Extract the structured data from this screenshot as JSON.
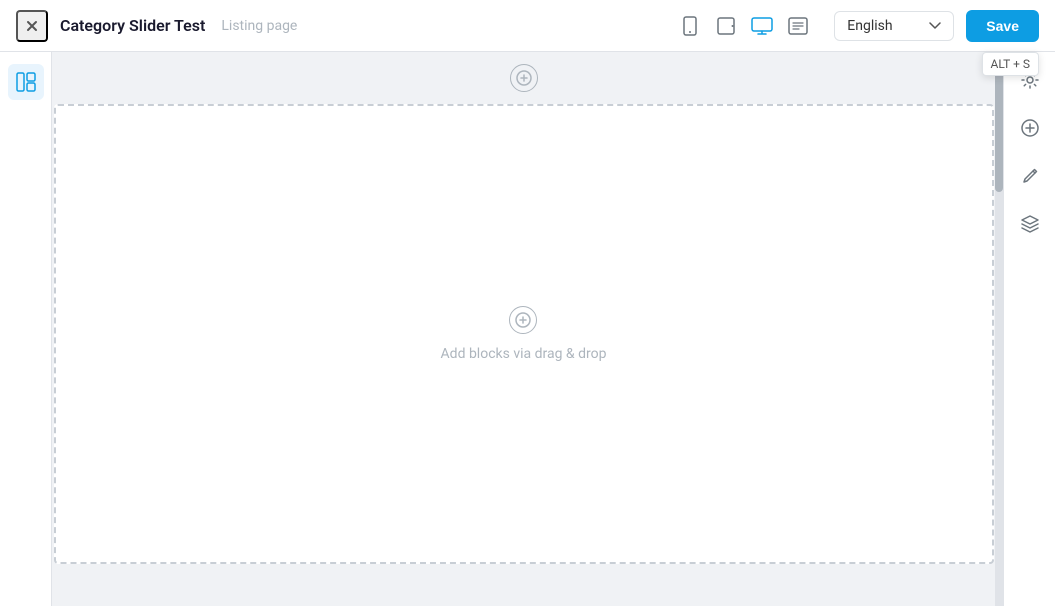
{
  "header": {
    "title": "Category Slider Test",
    "subtitle": "Listing page",
    "close_label": "×",
    "save_label": "Save",
    "tooltip_text": "ALT + S",
    "language": "English"
  },
  "views": [
    {
      "id": "mobile",
      "label": "Mobile view",
      "active": false
    },
    {
      "id": "tablet",
      "label": "Tablet view",
      "active": false
    },
    {
      "id": "desktop",
      "label": "Desktop view",
      "active": true
    },
    {
      "id": "list",
      "label": "List view",
      "active": false
    }
  ],
  "canvas": {
    "add_block_label": "Add blocks via drag & drop"
  },
  "left_sidebar": {
    "icons": [
      {
        "id": "layout-icon",
        "label": "Layout",
        "active": true
      }
    ]
  },
  "right_sidebar": {
    "icons": [
      {
        "id": "settings-icon",
        "label": "Settings"
      },
      {
        "id": "add-icon",
        "label": "Add"
      },
      {
        "id": "edit-icon",
        "label": "Edit"
      },
      {
        "id": "layers-icon",
        "label": "Layers"
      }
    ]
  }
}
